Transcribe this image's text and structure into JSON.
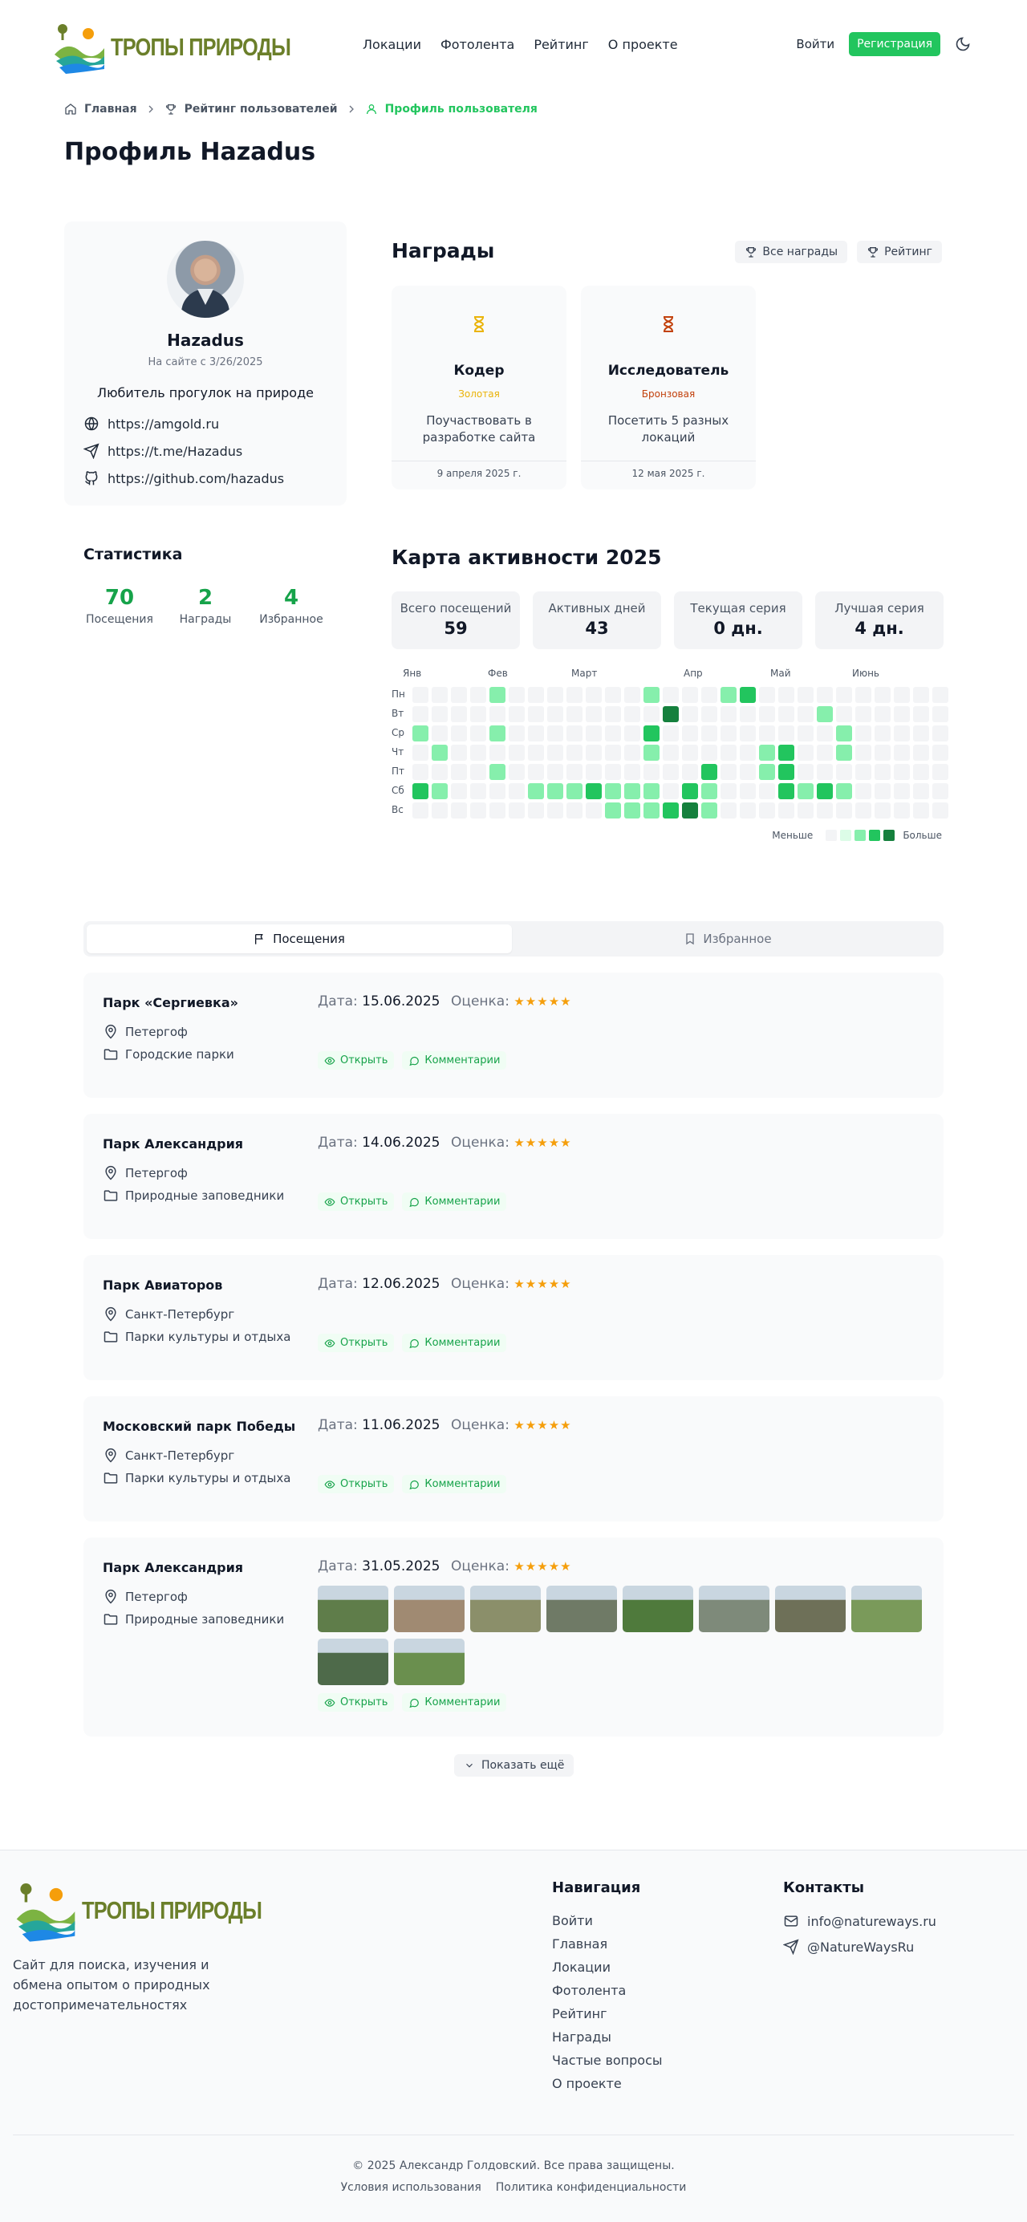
{
  "header": {
    "logo_text": "ТРОПЫ ПРИРОДЫ",
    "nav": [
      "Локации",
      "Фотолента",
      "Рейтинг",
      "О проекте"
    ],
    "login": "Войти",
    "register": "Регистрация"
  },
  "breadcrumb": [
    "Главная",
    "Рейтинг пользователей",
    "Профиль пользователя"
  ],
  "page_title": "Профиль Hazadus",
  "profile": {
    "name": "Hazadus",
    "since": "На сайте с 3/26/2025",
    "bio": "Любитель прогулок на природе",
    "links": [
      "https://amgold.ru",
      "https://t.me/Hazadus",
      "https://github.com/hazadus"
    ]
  },
  "awards": {
    "title": "Награды",
    "all_button": "Все награды",
    "rating_button": "Рейтинг",
    "items": [
      {
        "name": "Кодер",
        "level": "Золотая",
        "level_color": "#eab308",
        "desc": "Поучаствовать в разработке сайта",
        "date": "9 апреля 2025 г."
      },
      {
        "name": "Исследователь",
        "level": "Бронзовая",
        "level_color": "#c2410c",
        "desc": "Посетить 5 разных локаций",
        "date": "12 мая 2025 г."
      }
    ]
  },
  "stats": {
    "title": "Статистика",
    "items": [
      {
        "value": "70",
        "label": "Посещения"
      },
      {
        "value": "2",
        "label": "Награды"
      },
      {
        "value": "4",
        "label": "Избранное"
      }
    ]
  },
  "activity": {
    "title": "Карта активности 2025",
    "kpis": [
      {
        "label": "Всего посещений",
        "value": "59"
      },
      {
        "label": "Активных дней",
        "value": "43"
      },
      {
        "label": "Текущая серия",
        "value": "0 дн."
      },
      {
        "label": "Лучшая серия",
        "value": "4 дн."
      }
    ],
    "months": [
      "Янв",
      "Фев",
      "Март",
      "Апр",
      "Май",
      "Июнь"
    ],
    "days": [
      "Пн",
      "Вт",
      "Ср",
      "Чт",
      "Пт",
      "Сб",
      "Вс"
    ],
    "legend_less": "Меньше",
    "legend_more": "Больше",
    "levels": [
      "#f3f4f6",
      "#dcfce7",
      "#86efac",
      "#22c55e",
      "#15803d"
    ],
    "grid": [
      [
        0,
        0,
        0,
        0,
        2,
        0,
        0,
        0,
        0,
        0,
        0,
        0,
        2,
        0,
        0,
        0,
        2,
        3,
        0,
        0,
        0,
        0,
        0,
        0,
        0,
        0,
        0,
        0
      ],
      [
        0,
        0,
        0,
        0,
        0,
        0,
        0,
        0,
        0,
        0,
        0,
        0,
        0,
        4,
        0,
        0,
        0,
        0,
        0,
        0,
        0,
        2,
        0,
        0,
        0,
        0,
        0,
        0
      ],
      [
        2,
        0,
        0,
        0,
        2,
        0,
        0,
        0,
        0,
        0,
        0,
        0,
        3,
        0,
        0,
        0,
        0,
        0,
        0,
        0,
        0,
        0,
        2,
        0,
        0,
        0,
        0,
        0
      ],
      [
        0,
        2,
        0,
        0,
        0,
        0,
        0,
        0,
        0,
        0,
        0,
        0,
        2,
        0,
        0,
        0,
        0,
        0,
        2,
        3,
        0,
        0,
        2,
        0,
        0,
        0,
        0,
        0
      ],
      [
        0,
        0,
        0,
        0,
        2,
        0,
        0,
        0,
        0,
        0,
        0,
        0,
        0,
        0,
        0,
        3,
        0,
        0,
        2,
        3,
        0,
        0,
        0,
        0,
        0,
        0,
        0,
        0
      ],
      [
        3,
        2,
        0,
        0,
        0,
        0,
        2,
        2,
        2,
        3,
        2,
        2,
        2,
        0,
        3,
        2,
        0,
        0,
        0,
        3,
        2,
        3,
        2,
        0,
        0,
        0,
        0,
        0
      ],
      [
        0,
        0,
        0,
        0,
        0,
        0,
        0,
        0,
        0,
        0,
        2,
        2,
        2,
        3,
        4,
        2,
        0,
        0,
        0,
        0,
        0,
        0,
        0,
        0,
        0,
        0,
        0,
        0
      ]
    ]
  },
  "tabs": [
    "Посещения",
    "Избранное"
  ],
  "visits": [
    {
      "name": "Парк «Сергиевка»",
      "city": "Петергоф",
      "category": "Городские парки",
      "date_label": "Дата:",
      "date": "15.06.2025",
      "rating_label": "Оценка:",
      "stars": "★★★★★",
      "photos": []
    },
    {
      "name": "Парк Александрия",
      "city": "Петергоф",
      "category": "Природные заповедники",
      "date_label": "Дата:",
      "date": "14.06.2025",
      "rating_label": "Оценка:",
      "stars": "★★★★★",
      "photos": []
    },
    {
      "name": "Парк Авиаторов",
      "city": "Санкт-Петербург",
      "category": "Парки культуры и отдыха",
      "date_label": "Дата:",
      "date": "12.06.2025",
      "rating_label": "Оценка:",
      "stars": "★★★★★",
      "photos": []
    },
    {
      "name": "Московский парк Победы",
      "city": "Санкт-Петербург",
      "category": "Парки культуры и отдыха",
      "date_label": "Дата:",
      "date": "11.06.2025",
      "rating_label": "Оценка:",
      "stars": "★★★★★",
      "photos": []
    },
    {
      "name": "Парк Александрия",
      "city": "Петергоф",
      "category": "Природные заповедники",
      "date_label": "Дата:",
      "date": "31.05.2025",
      "rating_label": "Оценка:",
      "stars": "★★★★★",
      "photos": [
        "#5f7d4a",
        "#a08a72",
        "#8b8f6a",
        "#6f7a66",
        "#4f7a3c",
        "#7e8a7a",
        "#6e7058",
        "#7a9a5a",
        "#4e6a4a",
        "#6a8f4e"
      ]
    }
  ],
  "visit_buttons": {
    "open": "Открыть",
    "comments": "Комментарии"
  },
  "show_more": "Показать ещё",
  "footer": {
    "logo_text": "ТРОПЫ ПРИРОДЫ",
    "description": "Сайт для поиска, изучения и обмена опытом о природных достопримечательностях",
    "nav_title": "Навигация",
    "nav": [
      "Войти",
      "Главная",
      "Локации",
      "Фотолента",
      "Рейтинг",
      "Награды",
      "Частые вопросы",
      "О проекте"
    ],
    "contacts_title": "Контакты",
    "email": "info@natureways.ru",
    "telegram": "@NatureWaysRu",
    "copyright": "© 2025 Александр Голдовский. Все права защищены.",
    "terms": "Условия использования",
    "privacy": "Политика конфиденциальности"
  }
}
